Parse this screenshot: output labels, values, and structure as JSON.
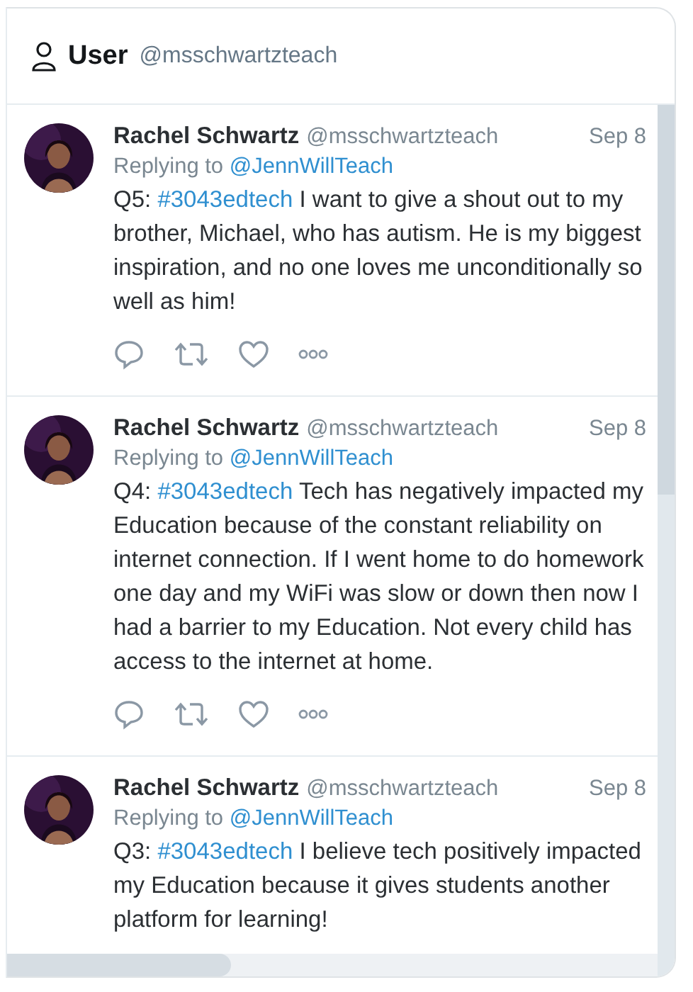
{
  "header": {
    "title": "User",
    "handle": "@msschwartzteach"
  },
  "tweets": [
    {
      "name": "Rachel Schwartz",
      "handle": "@msschwartzteach",
      "date": "Sep 8",
      "replying_label": "Replying to",
      "replying_to": "@JennWillTeach",
      "prefix": "Q5:",
      "hashtag": "#3043edtech",
      "text": "I want to give a shout out to my brother, Michael, who has autism. He is my biggest inspiration, and no one loves me unconditionally so well as him!",
      "actions": true
    },
    {
      "name": "Rachel Schwartz",
      "handle": "@msschwartzteach",
      "date": "Sep 8",
      "replying_label": "Replying to",
      "replying_to": "@JennWillTeach",
      "prefix": "Q4:",
      "hashtag": "#3043edtech",
      "text": "Tech has negatively impacted my Education because of the constant reliability on internet connection. If I went home to do homework one day and my WiFi was slow or down then now I had a barrier to my Education. Not every child has access to the internet at home.",
      "actions": true
    },
    {
      "name": "Rachel Schwartz",
      "handle": "@msschwartzteach",
      "date": "Sep 8",
      "replying_label": "Replying to",
      "replying_to": "@JennWillTeach",
      "prefix": "Q3:",
      "hashtag": "#3043edtech",
      "text": "I believe tech positively impacted my Education because it gives students another platform for learning!",
      "actions": false
    }
  ]
}
